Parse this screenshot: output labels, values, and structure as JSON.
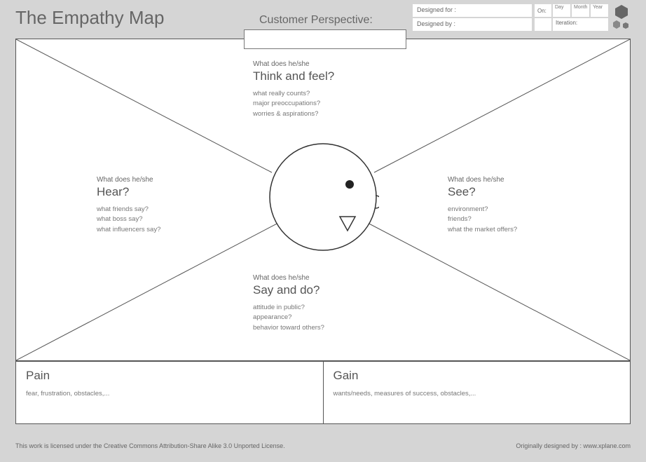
{
  "title": "The Empathy Map",
  "perspective_label": "Customer Perspective:",
  "meta": {
    "designed_for": "Designed for :",
    "designed_by": "Designed by :",
    "on": "On:",
    "day": "Day",
    "month": "Month",
    "year": "Year",
    "iteration": "Iteration:"
  },
  "quadrants": {
    "think": {
      "lead": "What does he/she",
      "head": "Think and feel?",
      "p1": "what really counts?",
      "p2": "major preoccupations?",
      "p3": "worries & aspirations?"
    },
    "hear": {
      "lead": "What does he/she",
      "head": "Hear?",
      "p1": "what friends say?",
      "p2": "what boss say?",
      "p3": "what influencers say?"
    },
    "see": {
      "lead": "What does he/she",
      "head": "See?",
      "p1": "environment?",
      "p2": "friends?",
      "p3": "what the market offers?"
    },
    "say": {
      "lead": "What does he/she",
      "head": "Say and do?",
      "p1": "attitude in public?",
      "p2": "appearance?",
      "p3": "behavior toward others?"
    }
  },
  "pain": {
    "title": "Pain",
    "text": "fear, frustration, obstacles,..."
  },
  "gain": {
    "title": "Gain",
    "text": "wants/needs, measures of success, obstacles,..."
  },
  "footer": {
    "license": "This work is licensed under the Creative Commons Attribution-Share Alike 3.0 Unported License.",
    "credit": "Originally designed by : www.xplane.com"
  }
}
